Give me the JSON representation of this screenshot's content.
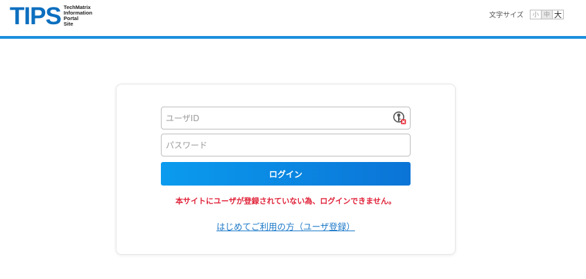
{
  "header": {
    "logo_text": "TIPS",
    "logo_sub": [
      "TechMatrix",
      "Information",
      "Portal",
      "Site"
    ],
    "font_size_label": "文字サイズ",
    "font_size_options": [
      "小",
      "中",
      "大"
    ],
    "accent_color": "#1b8fdc"
  },
  "login": {
    "user_placeholder": "ユーザID",
    "user_value": "",
    "password_placeholder": "パスワード",
    "password_value": "",
    "login_button": "ログイン",
    "error_message": "本サイトにユーザが登録されていない為、ログインできません。",
    "register_link": "はじめてご利用の方（ユーザ登録）",
    "user_field_icon": "key-icon",
    "button_color": "#0a8ae6",
    "error_color": "#e0243a"
  }
}
